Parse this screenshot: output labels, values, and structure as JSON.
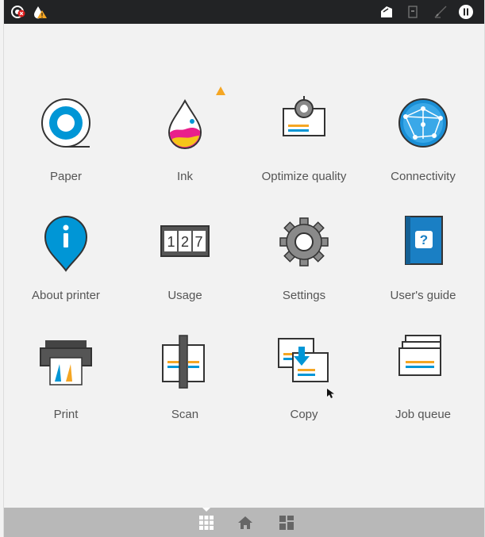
{
  "tiles": [
    {
      "label": "Paper"
    },
    {
      "label": "Ink"
    },
    {
      "label": "Optimize quality"
    },
    {
      "label": "Connectivity"
    },
    {
      "label": "About printer"
    },
    {
      "label": "Usage"
    },
    {
      "label": "Settings"
    },
    {
      "label": "User's guide"
    },
    {
      "label": "Print"
    },
    {
      "label": "Scan"
    },
    {
      "label": "Copy"
    },
    {
      "label": "Job queue"
    }
  ],
  "usage_counter": [
    "1",
    "2",
    "7"
  ],
  "icons": {
    "top_left": [
      "printer-status-error-icon",
      "warning-droplet-icon"
    ],
    "top_right": [
      "paper-feed-icon",
      "document-icon",
      "pen-edit-icon",
      "pause-icon"
    ],
    "bottom": [
      "apps-grid-icon",
      "home-icon",
      "widgets-icon"
    ]
  },
  "colors": {
    "accent_blue": "#0096d6",
    "warning": "#f5a623",
    "topbar": "#222325",
    "bottombar": "#b8b8b8"
  }
}
